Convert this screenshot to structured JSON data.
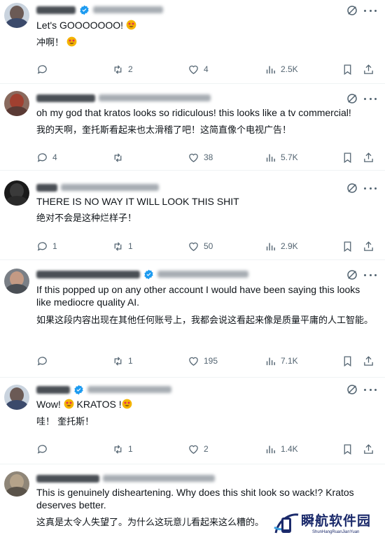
{
  "colors": {
    "text": "#0f1419",
    "muted": "#536471",
    "verified": "#1d9bf0",
    "divider": "#eff3f4",
    "emoji": "#f4b400",
    "watermark": "#1b2a6b"
  },
  "tweets": [
    {
      "text_en": "Let's GOOOOOOO! ",
      "text_zh": "冲啊！ ",
      "verified": true,
      "emoji_en": true,
      "emoji_zh": true,
      "replies": "",
      "reposts": "2",
      "likes": "4",
      "views": "2.5K"
    },
    {
      "text_en": "oh my god that kratos looks so ridiculous! this looks like a tv commercial!",
      "text_zh": "我的天啊，奎托斯看起来也太滑稽了吧！这简直像个电视广告！",
      "verified": false,
      "replies": "4",
      "reposts": "",
      "likes": "38",
      "views": "5.7K"
    },
    {
      "text_en": "THERE IS NO WAY IT WILL LOOK THIS SHIT",
      "text_zh": "绝对不会是这种烂样子！",
      "verified": false,
      "replies": "1",
      "reposts": "1",
      "likes": "50",
      "views": "2.9K"
    },
    {
      "text_en": "If this popped up on any other account I would have been saying this looks like mediocre quality AI.",
      "text_zh": "如果这段内容出现在其他任何账号上，我都会说这看起来像是质量平庸的人工智能。",
      "verified": true,
      "replies": "",
      "reposts": "1",
      "likes": "195",
      "views": "7.1K"
    },
    {
      "text_en": "Wow! ",
      "text_en_mid": " KRATOS !",
      "text_zh": "哇！ 奎托斯！",
      "verified": true,
      "replies": "",
      "reposts": "1",
      "likes": "2",
      "views": "1.4K"
    },
    {
      "text_en": "This is genuinely disheartening. Why does this shit look so wack!? Kratos deserves better.",
      "text_zh": "这真是太令人失望了。为什么这玩意儿看起来这么糟的。",
      "verified": false
    }
  ],
  "watermark": {
    "title": "瞬航软件园",
    "subtitle": "ShunHangRuanJianYuan"
  }
}
